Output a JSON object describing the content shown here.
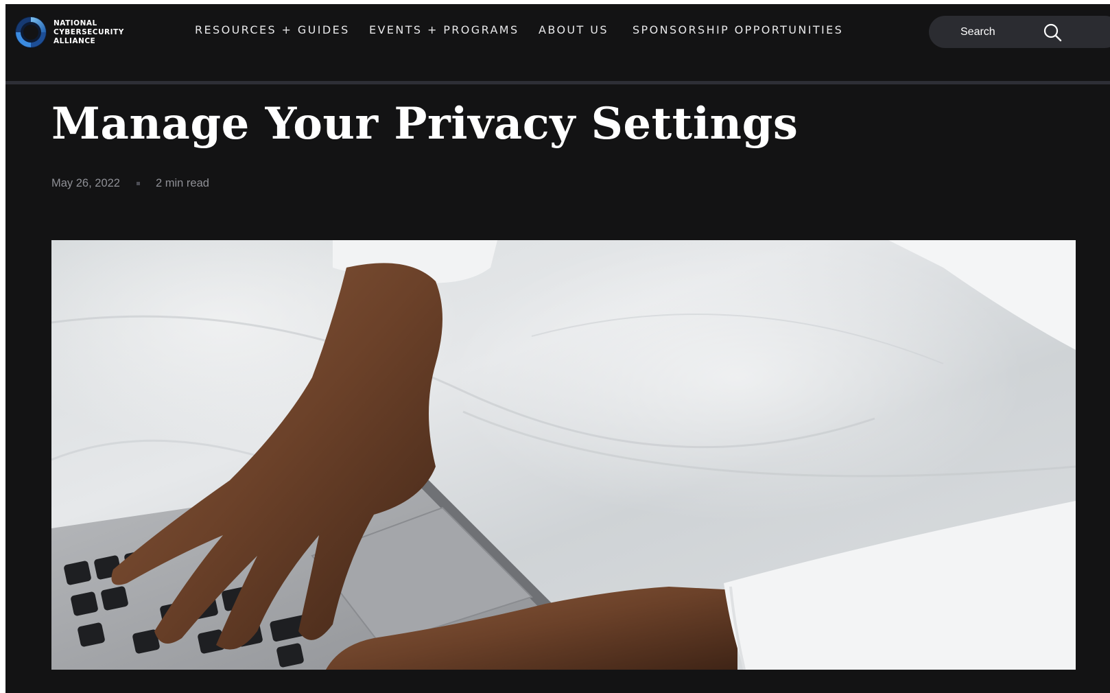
{
  "header": {
    "logo_lines": [
      "NATIONAL",
      "CYBERSECURITY",
      "ALLIANCE"
    ],
    "nav": [
      {
        "label": "RESOURCES + GUIDES"
      },
      {
        "label": "EVENTS + PROGRAMS"
      },
      {
        "label": "ABOUT US"
      },
      {
        "label": "SPONSORSHIP OPPORTUNITIES"
      }
    ],
    "search": {
      "placeholder": "Search",
      "icon": "search-icon"
    }
  },
  "article": {
    "title": "Manage Your Privacy Settings",
    "date": "May 26, 2022",
    "read_time": "2 min read",
    "hero_image": "hands typing on a laptop keyboard on white bedsheets"
  },
  "colors": {
    "background": "#131314",
    "header_rule": "#2e2f36",
    "search_bg": "#2b2c31",
    "meta_text": "#8f9096",
    "logo_blue": "#2f7fd0"
  }
}
